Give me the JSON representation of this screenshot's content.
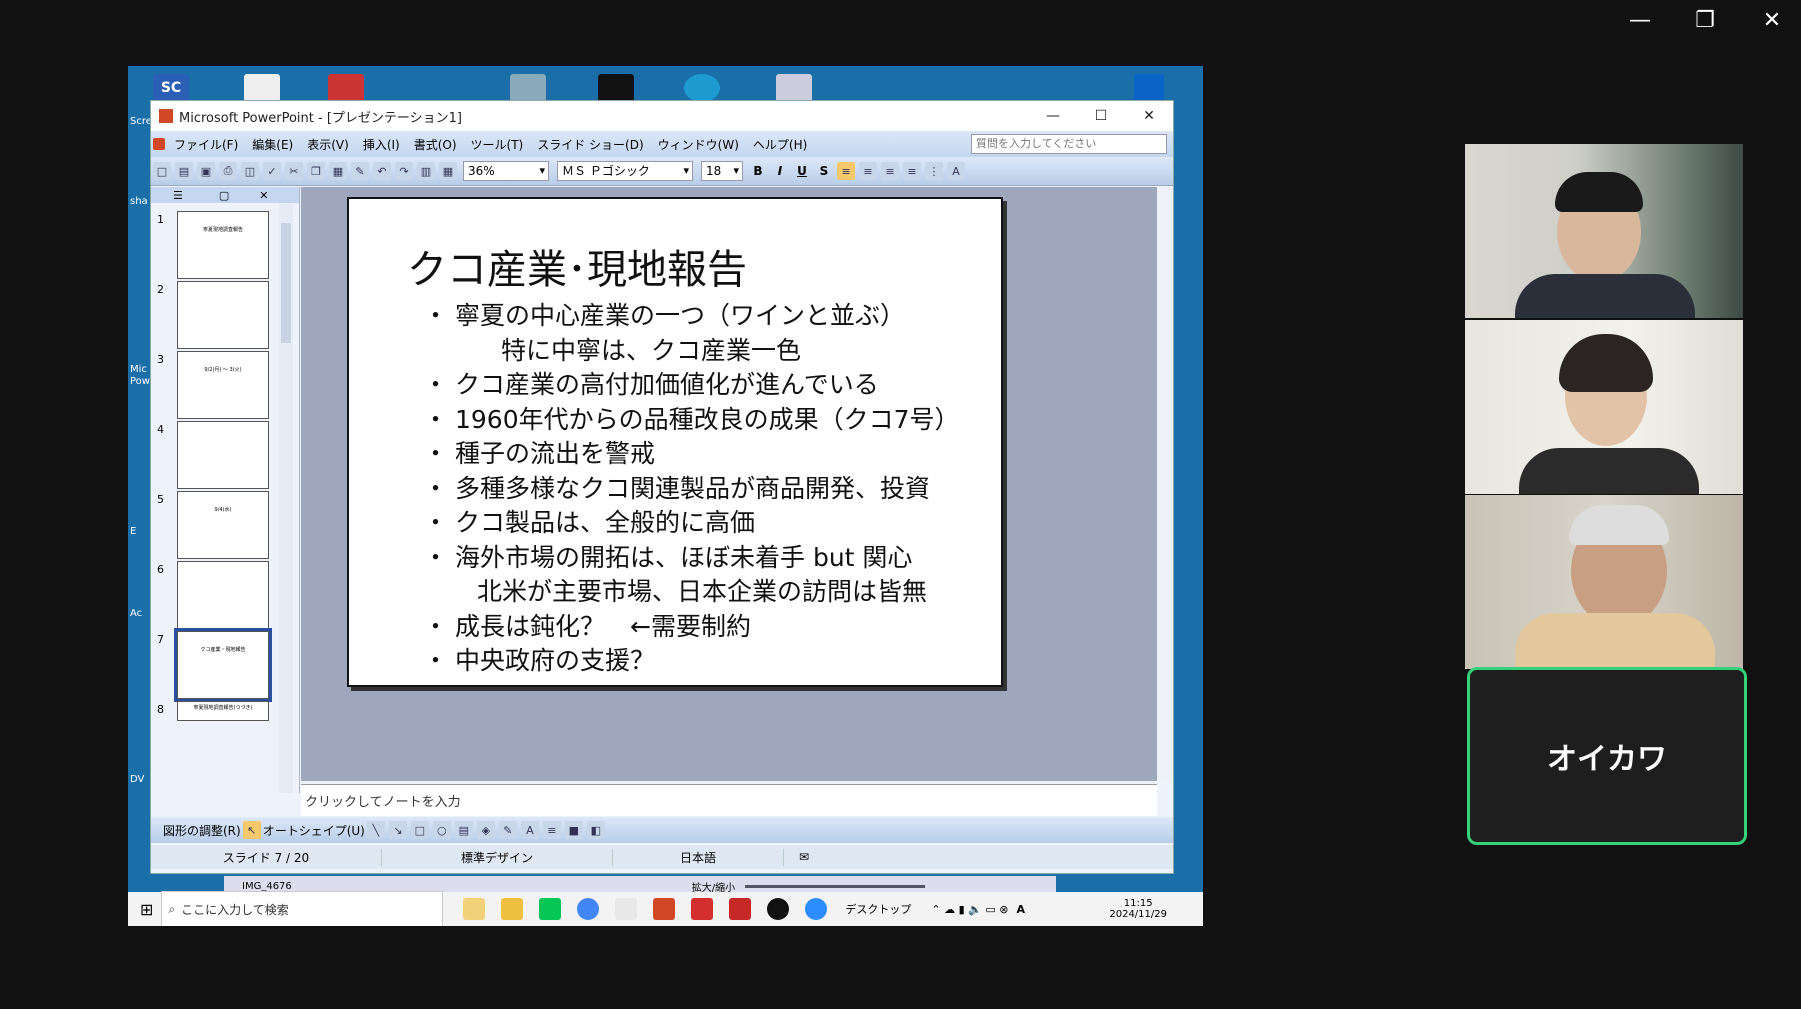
{
  "window_controls": {
    "minimize": "—",
    "maximize": "❐",
    "close": "✕"
  },
  "desktop_side_labels": [
    "Scre",
    "sha",
    "Mic",
    "Pow",
    "E",
    "Ac",
    "DV"
  ],
  "ppt": {
    "title": "Microsoft PowerPoint - [プレゼンテーション1]",
    "menu": [
      "ファイル(F)",
      "編集(E)",
      "表示(V)",
      "挿入(I)",
      "書式(O)",
      "ツール(T)",
      "スライド ショー(D)",
      "ウィンドウ(W)",
      "ヘルプ(H)"
    ],
    "help_placeholder": "質問を入力してください",
    "zoom": "36%",
    "font": "ＭＳ Ｐゴシック",
    "font_size": "18",
    "bold": "B",
    "italic": "I",
    "underline": "U",
    "shadow": "S"
  },
  "thumbnails": [
    {
      "num": "1",
      "text": "寧夏現地調査報告"
    },
    {
      "num": "2",
      "text": ""
    },
    {
      "num": "3",
      "text": "9/2(月) ～ 3(火)"
    },
    {
      "num": "4",
      "text": ""
    },
    {
      "num": "5",
      "text": "9/4(水)"
    },
    {
      "num": "6",
      "text": ""
    },
    {
      "num": "7",
      "text": "クコ産業・現地報告"
    },
    {
      "num": "8",
      "text": "寧夏現地調査報告(つづき)"
    }
  ],
  "slide": {
    "title": "クコ産業･現地報告",
    "bullet_mark": "・",
    "bullets": [
      "寧夏の中心産業の一つ（ワインと並ぶ）",
      "特に中寧は、クコ産業一色",
      "クコ産業の高付加価値化が進んでいる",
      "1960年代からの品種改良の成果（クコ7号）",
      "種子の流出を警戒",
      "多種多様なクコ関連製品が商品開発、投資",
      "クコ製品は、全般的に高価",
      "海外市場の開拓は、ほぼ未着手 but 関心",
      "北米が主要市場、日本企業の訪問は皆無",
      "成長は鈍化？　←需要制約",
      "中央政府の支援？"
    ]
  },
  "notes_placeholder": "クリックしてノートを入力",
  "drawbar": {
    "adjust": "図形の調整(R)",
    "autoshape": "オートシェイプ(U)"
  },
  "status": {
    "slide": "スライド 7 / 20",
    "design": "標準デザイン",
    "lang": "日本語"
  },
  "photo_strip": {
    "file": "IMG_4676",
    "zoom": "拡大/縮小"
  },
  "taskbar": {
    "search_placeholder": "ここに入力して検索",
    "desktop": "デスクトップ",
    "time": "11:15",
    "date": "2024/11/29",
    "ime": "A"
  },
  "participant_name": "オイカワ",
  "colors": {
    "speaker_border": "#34d17a",
    "desktop_bg": "#1a6fa8"
  }
}
